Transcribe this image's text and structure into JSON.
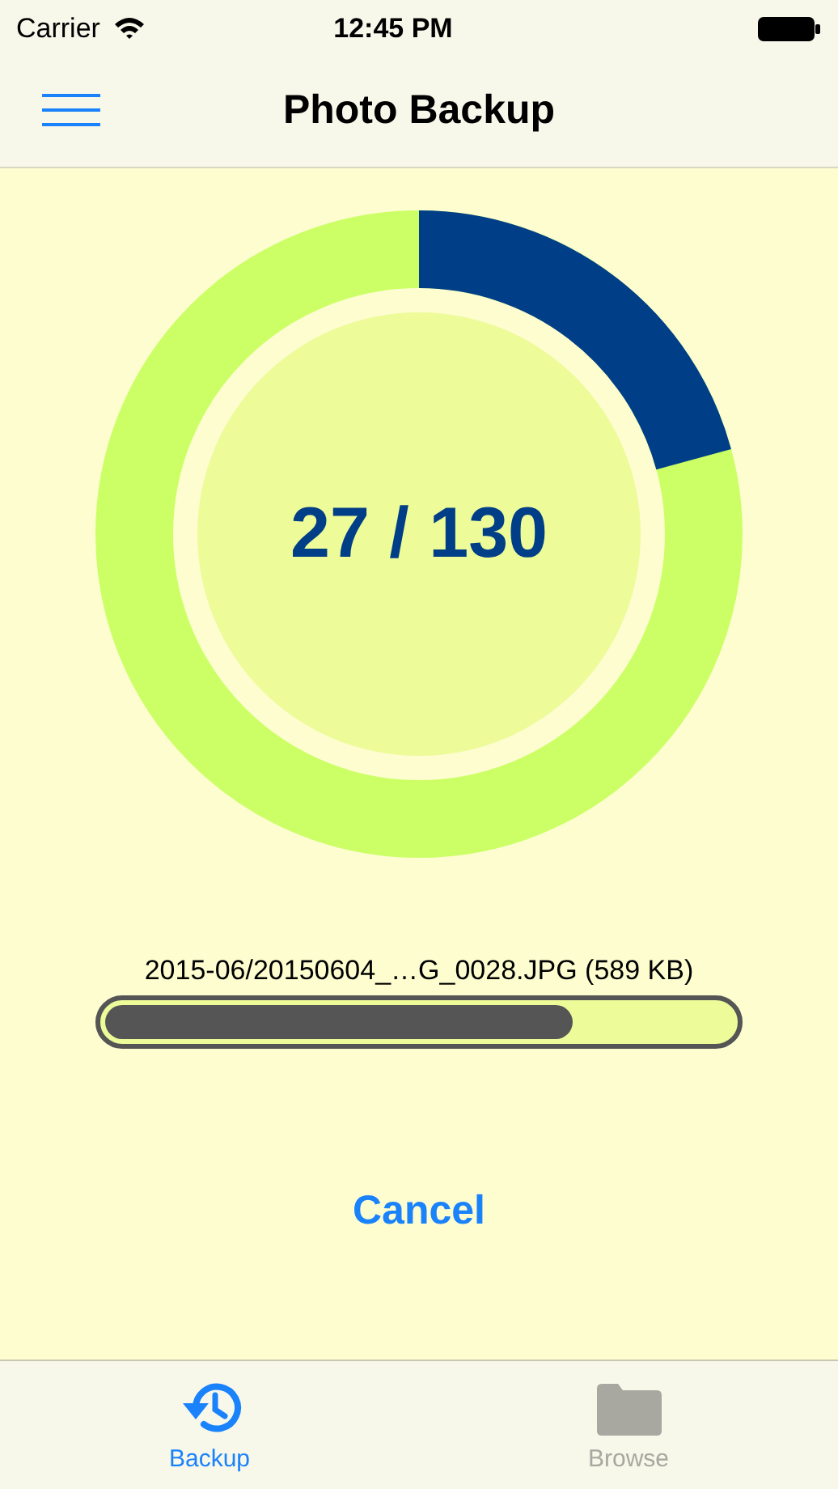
{
  "status_bar": {
    "carrier": "Carrier",
    "time": "12:45 PM"
  },
  "nav": {
    "title": "Photo Backup"
  },
  "ring": {
    "count": "27 / 130"
  },
  "file": {
    "name": "2015-06/20150604_…G_0028.JPG (589 KB)",
    "level": 0.745
  },
  "cancel": "Cancel",
  "tabs": [
    {
      "label": "Backup",
      "kind": "history",
      "selected": true
    },
    {
      "label": "Browse",
      "kind": "folder",
      "selected": false
    }
  ]
}
